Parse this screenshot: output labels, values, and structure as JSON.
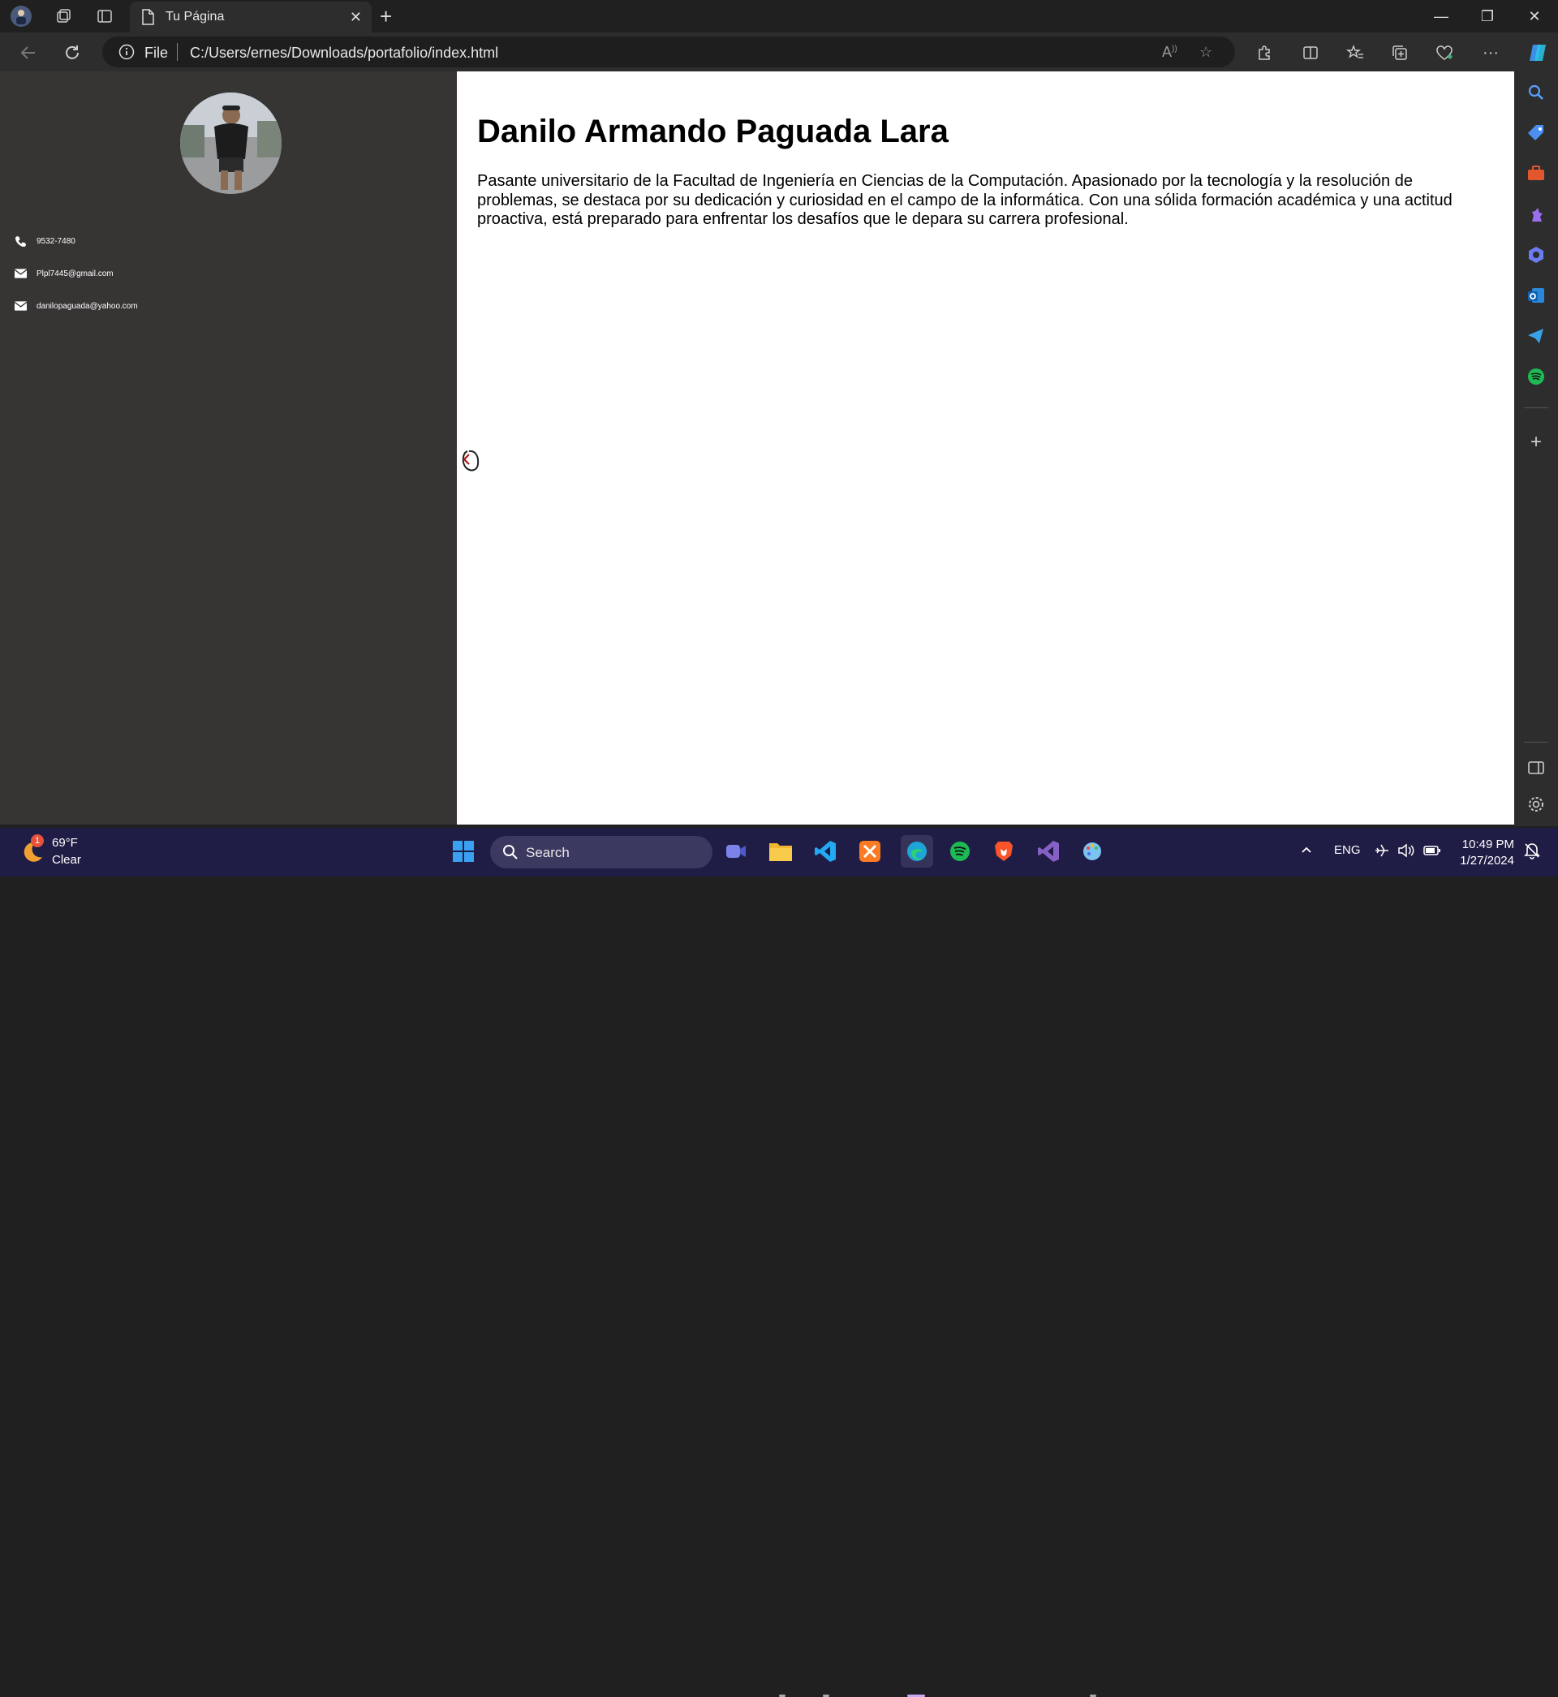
{
  "browser": {
    "tab_title": "Tu Página",
    "address_scheme": "File",
    "url": "C:/Users/ernes/Downloads/portafolio/index.html"
  },
  "page": {
    "name": "Danilo Armando Paguada Lara",
    "bio": "Pasante universitario de la Facultad de Ingeniería en Ciencias de la Computación. Apasionado por la tecnología y la resolución de problemas, se destaca por su dedicación y curiosidad en el campo de la informática. Con una sólida formación académica y una actitud proactiva, está preparado para enfrentar los desafíos que le depara su carrera profesional.",
    "contacts": {
      "phone": "9532-7480",
      "email_1": "Plpl7445@gmail.com",
      "email_2": "danilopaguada@yahoo.com"
    }
  },
  "taskbar": {
    "weather_temp": "69°F",
    "weather_desc": "Clear",
    "weather_badge": "1",
    "search_label": "Search",
    "language": "ENG",
    "time": "10:49 PM",
    "date": "1/27/2024"
  },
  "colors": {
    "sidebar_bg": "#373434",
    "taskbar_bg": "#1f1d45",
    "browser_chrome": "#202020"
  }
}
